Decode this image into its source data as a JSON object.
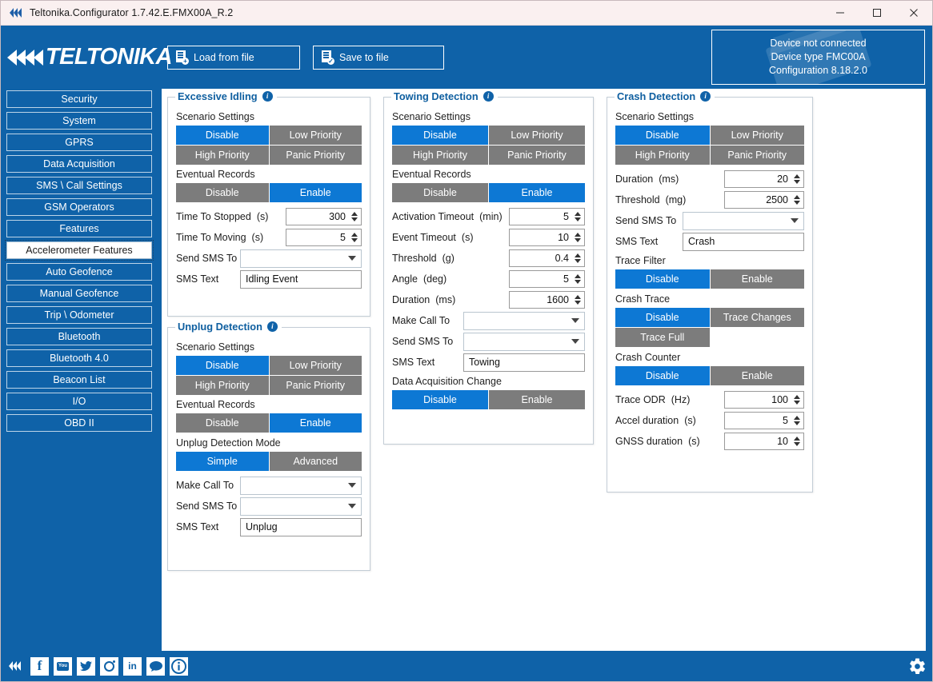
{
  "window": {
    "title": "Teltonika.Configurator 1.7.42.E.FMX00A_R.2",
    "minimize": "—",
    "maximize": "□",
    "close": "✕"
  },
  "toolbar": {
    "load_label": "Load from file",
    "save_label": "Save to file",
    "brand": "TELTONIKA"
  },
  "device": {
    "status": "Device not connected",
    "type": "Device type  FMC00A",
    "configuration": "Configuration  8.18.2.0"
  },
  "colors": {
    "accent_blue": "#0f62a8",
    "toggle_on": "#0d78d4",
    "toggle_off": "#7c7c7c",
    "titlebar": "#faf0f0"
  },
  "sidebar": {
    "items": [
      {
        "label": "Security",
        "active": false
      },
      {
        "label": "System",
        "active": false
      },
      {
        "label": "GPRS",
        "active": false
      },
      {
        "label": "Data Acquisition",
        "active": false
      },
      {
        "label": "SMS \\ Call Settings",
        "active": false
      },
      {
        "label": "GSM Operators",
        "active": false
      },
      {
        "label": "Features",
        "active": false
      },
      {
        "label": "Accelerometer Features",
        "active": true
      },
      {
        "label": "Auto Geofence",
        "active": false
      },
      {
        "label": "Manual Geofence",
        "active": false
      },
      {
        "label": "Trip \\ Odometer",
        "active": false
      },
      {
        "label": "Bluetooth",
        "active": false
      },
      {
        "label": "Bluetooth 4.0",
        "active": false
      },
      {
        "label": "Beacon List",
        "active": false
      },
      {
        "label": "I/O",
        "active": false
      },
      {
        "label": "OBD II",
        "active": false
      }
    ]
  },
  "panels": {
    "excessive_idling": {
      "title": "Excessive Idling",
      "scenario_label": "Scenario Settings",
      "scenario": [
        "Disable",
        "Low Priority",
        "High Priority",
        "Panic Priority"
      ],
      "scenario_selected": "Disable",
      "eventual_label": "Eventual Records",
      "eventual": [
        "Disable",
        "Enable"
      ],
      "eventual_selected": "Enable",
      "time_to_stopped_label": "Time To Stopped",
      "time_to_stopped_unit": "(s)",
      "time_to_stopped_value": "300",
      "time_to_moving_label": "Time To Moving",
      "time_to_moving_unit": "(s)",
      "time_to_moving_value": "5",
      "send_sms_label": "Send SMS To",
      "send_sms_value": "",
      "sms_text_label": "SMS Text",
      "sms_text_value": "Idling Event"
    },
    "unplug_detection": {
      "title": "Unplug Detection",
      "scenario_label": "Scenario Settings",
      "scenario": [
        "Disable",
        "Low Priority",
        "High Priority",
        "Panic Priority"
      ],
      "scenario_selected": "Disable",
      "eventual_label": "Eventual Records",
      "eventual": [
        "Disable",
        "Enable"
      ],
      "eventual_selected": "Enable",
      "mode_label": "Unplug Detection Mode",
      "mode": [
        "Simple",
        "Advanced"
      ],
      "mode_selected": "Simple",
      "make_call_label": "Make Call To",
      "make_call_value": "",
      "send_sms_label": "Send SMS To",
      "send_sms_value": "",
      "sms_text_label": "SMS Text",
      "sms_text_value": "Unplug"
    },
    "towing_detection": {
      "title": "Towing Detection",
      "scenario_label": "Scenario Settings",
      "scenario": [
        "Disable",
        "Low Priority",
        "High Priority",
        "Panic Priority"
      ],
      "scenario_selected": "Disable",
      "eventual_label": "Eventual Records",
      "eventual": [
        "Disable",
        "Enable"
      ],
      "eventual_selected": "Enable",
      "activation_timeout_label": "Activation Timeout",
      "activation_timeout_unit": "(min)",
      "activation_timeout_value": "5",
      "event_timeout_label": "Event Timeout",
      "event_timeout_unit": "(s)",
      "event_timeout_value": "10",
      "threshold_label": "Threshold",
      "threshold_unit": "(g)",
      "threshold_value": "0.4",
      "angle_label": "Angle",
      "angle_unit": "(deg)",
      "angle_value": "5",
      "duration_label": "Duration",
      "duration_unit": "(ms)",
      "duration_value": "1600",
      "make_call_label": "Make Call To",
      "make_call_value": "",
      "send_sms_label": "Send SMS To",
      "send_sms_value": "",
      "sms_text_label": "SMS Text",
      "sms_text_value": "Towing",
      "daq_label": "Data Acquisition Change",
      "daq": [
        "Disable",
        "Enable"
      ],
      "daq_selected": "Disable"
    },
    "crash_detection": {
      "title": "Crash Detection",
      "scenario_label": "Scenario Settings",
      "scenario": [
        "Disable",
        "Low Priority",
        "High Priority",
        "Panic Priority"
      ],
      "scenario_selected": "Disable",
      "duration_label": "Duration",
      "duration_unit": "(ms)",
      "duration_value": "20",
      "threshold_label": "Threshold",
      "threshold_unit": "(mg)",
      "threshold_value": "2500",
      "send_sms_label": "Send SMS To",
      "send_sms_value": "",
      "sms_text_label": "SMS Text",
      "sms_text_value": "Crash",
      "trace_filter_label": "Trace Filter",
      "trace_filter": [
        "Disable",
        "Enable"
      ],
      "trace_filter_selected": "Disable",
      "crash_trace_label": "Crash Trace",
      "crash_trace": [
        "Disable",
        "Trace Changes",
        "Trace Full"
      ],
      "crash_trace_selected": "Disable",
      "crash_counter_label": "Crash Counter",
      "crash_counter": [
        "Disable",
        "Enable"
      ],
      "crash_counter_selected": "Disable",
      "trace_odr_label": "Trace ODR",
      "trace_odr_unit": "(Hz)",
      "trace_odr_value": "100",
      "accel_duration_label": "Accel duration",
      "accel_duration_unit": "(s)",
      "accel_duration_value": "5",
      "gnss_duration_label": "GNSS duration",
      "gnss_duration_unit": "(s)",
      "gnss_duration_value": "10"
    }
  },
  "footer": {
    "social": [
      {
        "name": "teltonika-logo-icon",
        "glyph": ""
      },
      {
        "name": "facebook-icon",
        "glyph": "f"
      },
      {
        "name": "youtube-icon",
        "glyph": "You"
      },
      {
        "name": "twitter-icon",
        "glyph": "🐦"
      },
      {
        "name": "instagram-icon",
        "glyph": ""
      },
      {
        "name": "linkedin-icon",
        "glyph": "in"
      },
      {
        "name": "forum-icon",
        "glyph": "💬"
      },
      {
        "name": "info-icon",
        "glyph": "i"
      }
    ],
    "settings": "gear-icon"
  }
}
